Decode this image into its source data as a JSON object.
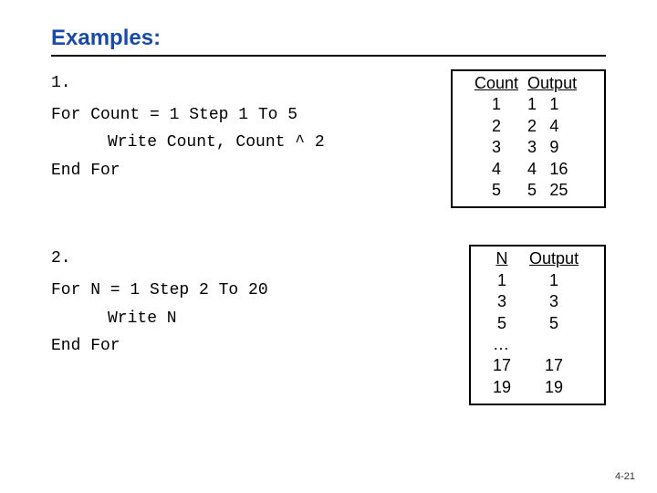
{
  "heading": "Examples:",
  "ex1": {
    "num": "1.",
    "line1": "For Count = 1 Step 1 To 5",
    "line2": "Write Count, Count ^ 2",
    "line3": "End For",
    "table": {
      "h1": "Count",
      "h2": "Output",
      "rows": [
        {
          "c": "1",
          "o1": "1",
          "o2": "1"
        },
        {
          "c": "2",
          "o1": "2",
          "o2": "4"
        },
        {
          "c": "3",
          "o1": "3",
          "o2": "9"
        },
        {
          "c": "4",
          "o1": "4",
          "o2": "16"
        },
        {
          "c": "5",
          "o1": "5",
          "o2": "25"
        }
      ]
    }
  },
  "ex2": {
    "num": "2.",
    "line1": "For N = 1 Step 2 To 20",
    "line2": "Write N",
    "line3": "End For",
    "table": {
      "h1": "N",
      "h2": "Output",
      "rows": [
        {
          "n": "1",
          "o": "1"
        },
        {
          "n": "3",
          "o": "3"
        },
        {
          "n": "5",
          "o": "5"
        },
        {
          "n": "…",
          "o": ""
        },
        {
          "n": "17",
          "o": "17"
        },
        {
          "n": "19",
          "o": "19"
        }
      ]
    }
  },
  "footer": "4-21"
}
